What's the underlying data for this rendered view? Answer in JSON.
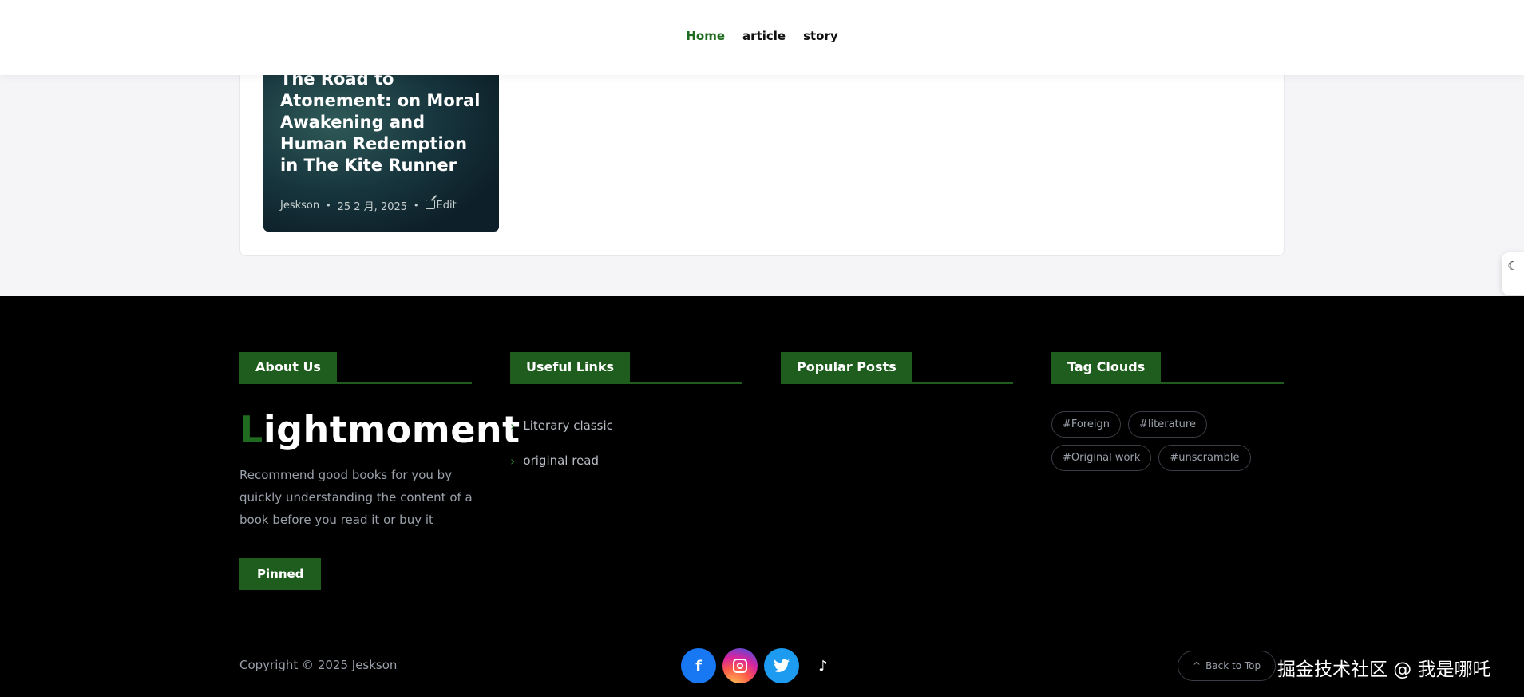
{
  "nav": {
    "items": [
      {
        "label": "Home",
        "active": true
      },
      {
        "label": "article",
        "active": false
      },
      {
        "label": "story",
        "active": false
      }
    ]
  },
  "card": {
    "title": "The Road to Atonement: on Moral Awakening and Human Redemption in The Kite Runner",
    "author": "Jeskson",
    "date": "25 2 月, 2025",
    "edit_label": "Edit"
  },
  "dark_mode_toggle": {
    "icon": "moon-icon"
  },
  "footer": {
    "about": {
      "heading": "About Us",
      "logo_first_letter": "L",
      "logo_rest": "ightmoment",
      "description": "Recommend good books for you by quickly understanding the content of a book before you read it or buy it",
      "pinned_label": "Pinned"
    },
    "useful_links": {
      "heading": "Useful Links",
      "items": [
        "Literary classic",
        "original read"
      ]
    },
    "popular_posts": {
      "heading": "Popular Posts"
    },
    "tag_clouds": {
      "heading": "Tag Clouds",
      "tags": [
        "#Foreign",
        "#literature",
        "#Original work",
        "#unscramble"
      ]
    },
    "copyright": "Copyright © 2025 Jeskson",
    "socials": [
      "facebook-icon",
      "instagram-icon",
      "twitter-icon",
      "tiktok-icon"
    ],
    "back_to_top": "Back to Top",
    "watermark": "掘金技术社区 @ 我是哪吒"
  },
  "colors": {
    "accent": "#1f5d1f",
    "footer_bg": "#000000"
  }
}
